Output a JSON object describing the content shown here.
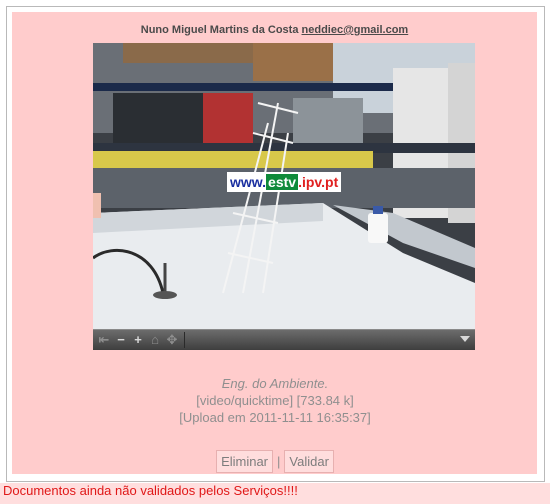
{
  "author": {
    "name": "Nuno Miguel Martins da Costa",
    "email": "neddiec@gmail.com"
  },
  "video": {
    "logo": {
      "www": "www.",
      "estv": "estv",
      "suffix": ".ipv.pt"
    },
    "controls": [
      "previous-icon",
      "zoom-out-icon",
      "zoom-in-icon",
      "home-icon",
      "fullscreen-icon",
      "menu-icon"
    ]
  },
  "details": {
    "course": "Eng. do Ambiente.",
    "mime": "[video/quicktime] [733.84 k]",
    "upload": "[Upload em 2011-11-11 16:35:37]"
  },
  "actions": {
    "delete_label": "Eliminar",
    "separator": "|",
    "validate_label": "Validar"
  },
  "footer": {
    "warning": "Documentos ainda não validados pelos Serviços!!!!"
  },
  "colors": {
    "panel_bg": "#ffcccc",
    "warning_text": "#e01818"
  }
}
